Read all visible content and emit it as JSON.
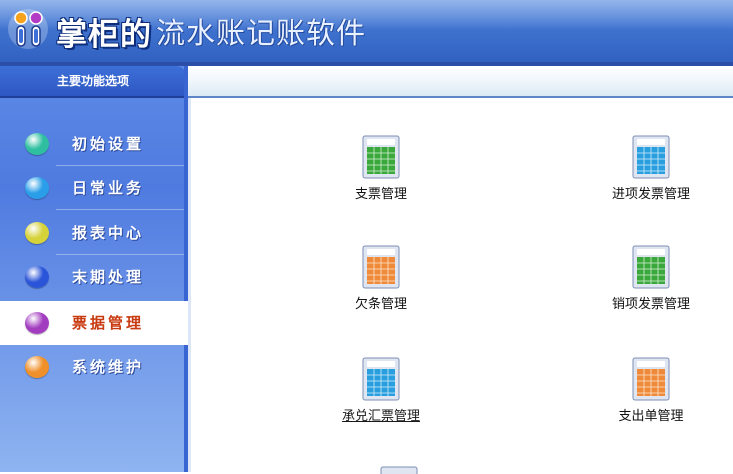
{
  "app": {
    "title_bold": "掌柜的",
    "title_rest": "流水账记账软件",
    "logo_icon": "two-figures-logo-icon"
  },
  "sidebar": {
    "header": "主要功能选项",
    "items": [
      {
        "label": "初始设置",
        "ball_color": "#2fbfa0",
        "active": false
      },
      {
        "label": "日常业务",
        "ball_color": "#2a9ee8",
        "active": false
      },
      {
        "label": "报表中心",
        "ball_color": "#d6d23a",
        "active": false
      },
      {
        "label": "末期处理",
        "ball_color": "#2b55d8",
        "active": false
      },
      {
        "label": "票据管理",
        "ball_color": "#a33dc0",
        "active": true
      },
      {
        "label": "系统维护",
        "ball_color": "#f0902a",
        "active": false
      }
    ]
  },
  "main": {
    "functions": [
      {
        "label": "支票管理",
        "icon": "green-spreadsheet-icon",
        "underlined": false
      },
      {
        "label": "进项发票管理",
        "icon": "blue-spreadsheet-icon",
        "underlined": false
      },
      {
        "label": "欠条管理",
        "icon": "orange-spreadsheet-icon",
        "underlined": false
      },
      {
        "label": "销项发票管理",
        "icon": "green-spreadsheet-icon",
        "underlined": false
      },
      {
        "label": "承兑汇票管理",
        "icon": "blue-spreadsheet-icon",
        "underlined": true
      },
      {
        "label": "支出单管理",
        "icon": "orange-spreadsheet-icon",
        "underlined": false
      }
    ]
  },
  "colors": {
    "header_blue": "#3f72cf",
    "sidebar_blue": "#4f7be0",
    "active_text": "#c83a10",
    "green_sheet": "#3aa83a",
    "blue_sheet": "#2a9fe0",
    "orange_sheet": "#ee8a3a"
  }
}
